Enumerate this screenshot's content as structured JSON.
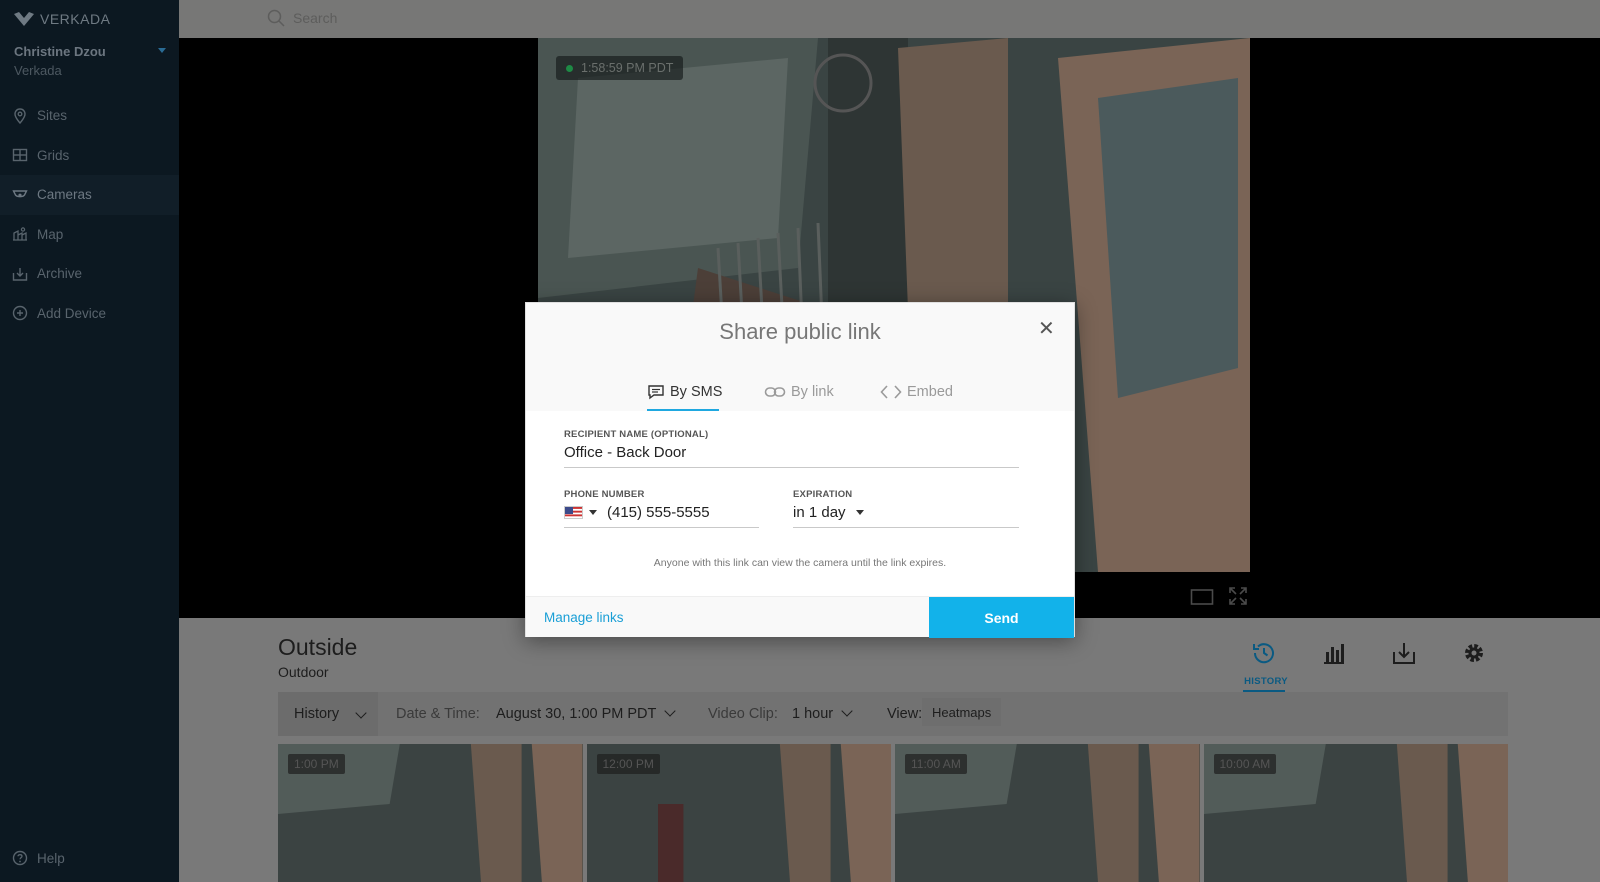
{
  "app": {
    "logo_text": "VERKADA"
  },
  "user": {
    "name": "Christine Dzou",
    "org": "Verkada"
  },
  "nav": {
    "items": [
      {
        "label": "Sites",
        "icon": "location-pin-icon"
      },
      {
        "label": "Grids",
        "icon": "grid-icon"
      },
      {
        "label": "Cameras",
        "icon": "camera-icon"
      },
      {
        "label": "Map",
        "icon": "map-icon"
      },
      {
        "label": "Archive",
        "icon": "archive-icon"
      },
      {
        "label": "Add Device",
        "icon": "add-circle-icon"
      }
    ],
    "help_label": "Help"
  },
  "search": {
    "placeholder": "Search"
  },
  "video": {
    "timestamp": "1:58:59 PM PDT"
  },
  "camera": {
    "title": "Outside",
    "subtitle": "Outdoor",
    "tools": {
      "history_label": "HISTORY"
    }
  },
  "filters": {
    "history": "History",
    "date_label": "Date & Time:",
    "date_value": "August 30, 1:00 PM PDT",
    "clip_label": "Video Clip:",
    "clip_value": "1 hour",
    "view_label": "View:",
    "view_value": "Heatmaps"
  },
  "thumbnails": [
    {
      "time": "1:00 PM"
    },
    {
      "time": "12:00 PM"
    },
    {
      "time": "11:00 AM"
    },
    {
      "time": "10:00 AM"
    }
  ],
  "modal": {
    "title": "Share public link",
    "tabs": [
      {
        "label": "By SMS",
        "icon": "message-icon",
        "active": true
      },
      {
        "label": "By link",
        "icon": "link-icon",
        "active": false
      },
      {
        "label": "Embed",
        "icon": "code-icon",
        "active": false
      }
    ],
    "recipient_label": "RECIPIENT NAME (OPTIONAL)",
    "recipient_value": "Office - Back Door",
    "phone_label": "PHONE NUMBER",
    "phone_value": "(415) 555-5555",
    "expiration_label": "EXPIRATION",
    "expiration_value": "in 1 day",
    "note": "Anyone with this link can view the camera until the link expires.",
    "manage_label": "Manage links",
    "send_label": "Send"
  },
  "colors": {
    "accent": "#12b2ea",
    "link": "#1a9fd6",
    "sidebar_bg": "#0c1821"
  }
}
